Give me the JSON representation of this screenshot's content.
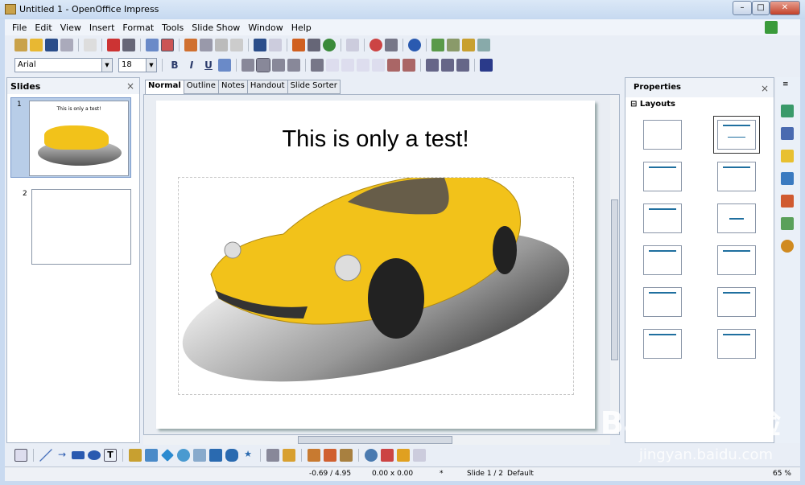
{
  "window": {
    "title": "Untitled 1 - OpenOffice Impress"
  },
  "menu": [
    "File",
    "Edit",
    "View",
    "Insert",
    "Format",
    "Tools",
    "Slide Show",
    "Window",
    "Help"
  ],
  "format_bar": {
    "font": "Arial",
    "size": "18",
    "bold": "B",
    "italic": "I",
    "underline": "U"
  },
  "slides_pane": {
    "title": "Slides",
    "close": "×",
    "slides": [
      {
        "number": "1",
        "thumb_title": "This is only a test!"
      },
      {
        "number": "2"
      }
    ]
  },
  "view_tabs": [
    "Normal",
    "Outline",
    "Notes",
    "Handout",
    "Slide Sorter"
  ],
  "active_tab": "Normal",
  "slide": {
    "title": "This is only a test!",
    "car_color": "#f2c21a"
  },
  "properties": {
    "title": "Properties",
    "close": "×",
    "section": "Layouts",
    "section_toggle": "⊟"
  },
  "status": {
    "position": "-0.69 / 4.95",
    "size": "0.00 x 0.00",
    "modified": "*",
    "slide": "Slide 1 / 2",
    "master": "Default",
    "zoom": "65 %"
  },
  "watermark": {
    "logo": "Bai du 经验",
    "url": "jingyan.baidu.com"
  }
}
